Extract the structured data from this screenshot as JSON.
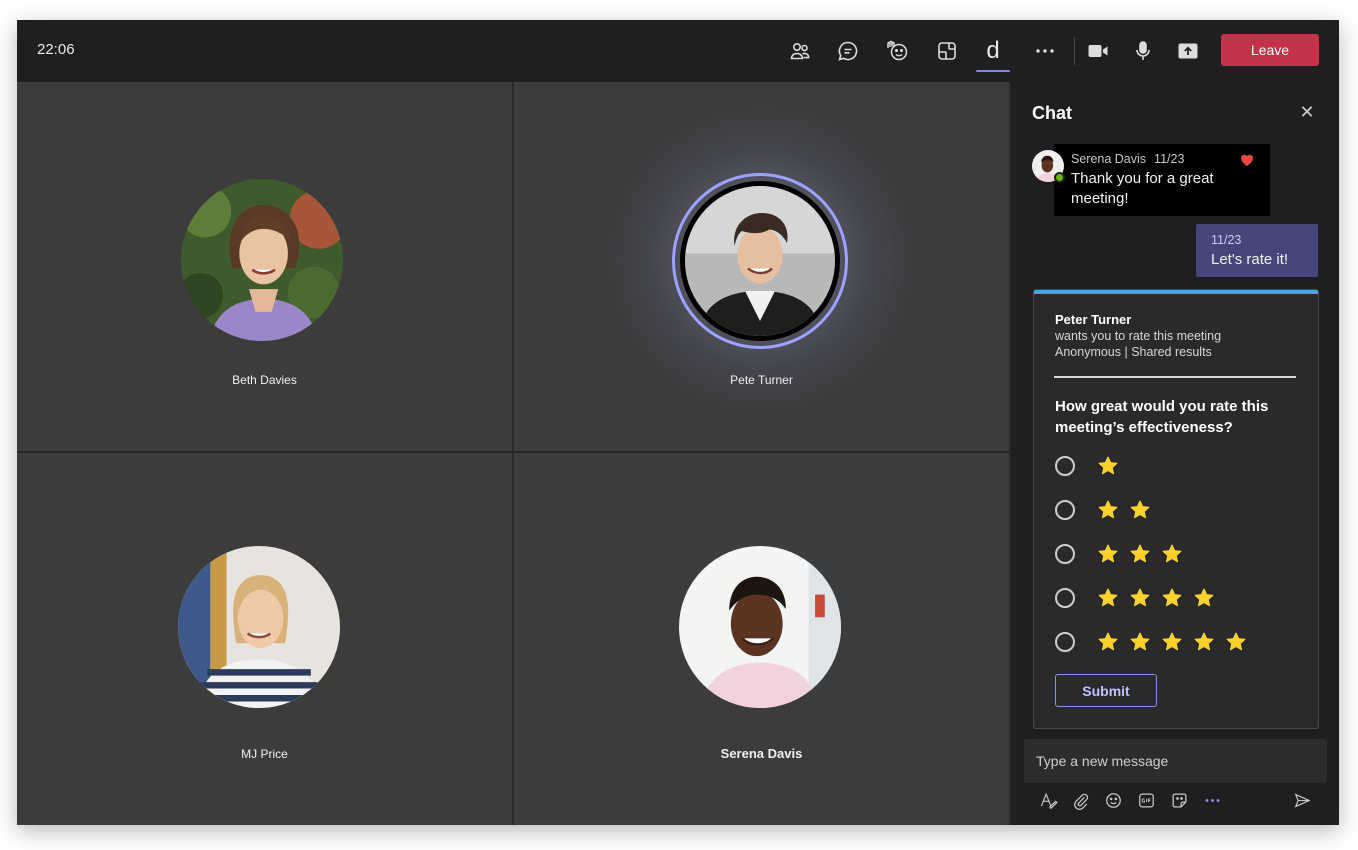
{
  "window": {
    "clock": "22:06"
  },
  "toolbar": {
    "icons": [
      "people-icon",
      "chat-icon",
      "reactions-icon",
      "rooms-icon",
      "app-d-icon",
      "more-icon",
      "camera-icon",
      "mic-icon",
      "share-icon"
    ],
    "app_letter": "d",
    "leave_label": "Leave",
    "leave_color": "#c4314b"
  },
  "participants": [
    {
      "name": "Beth Davies"
    },
    {
      "name": "Pete Turner",
      "speaking": true
    },
    {
      "name": "MJ Price"
    },
    {
      "name": "Serena Davis"
    }
  ],
  "chat": {
    "title": "Chat",
    "messages": [
      {
        "author": "Serena Davis",
        "time": "11/23",
        "text": "Thank you for a great meeting!",
        "reaction": "heart-icon"
      },
      {
        "time": "11/23",
        "text": "Let's rate it!",
        "self": true
      }
    ],
    "card": {
      "author": "Peter Turner",
      "subtitle": "wants you to rate this meeting",
      "meta": "Anonymous | Shared results",
      "question": "How great would you rate this meeting’s effectiveness?",
      "options": [
        1,
        2,
        3,
        4,
        5
      ],
      "submit_label": "Submit",
      "accent_color": "#4aa3df",
      "star_color": "#f8d22a"
    },
    "compose": {
      "placeholder": "Type a new message",
      "tools": [
        "format-icon",
        "attach-icon",
        "emoji-icon",
        "gif-icon",
        "sticker-icon",
        "more-options-icon",
        "send-icon"
      ]
    }
  }
}
